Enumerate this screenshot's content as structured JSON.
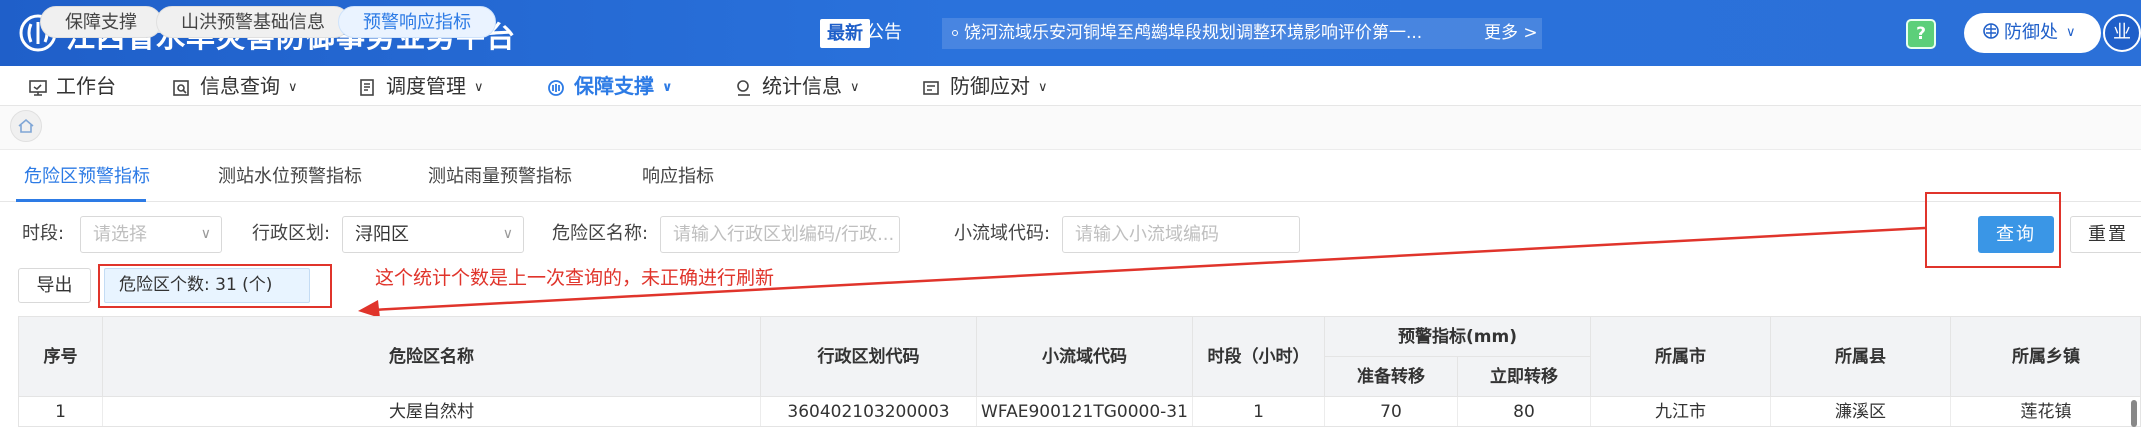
{
  "header": {
    "title": "江西省水旱灾害防御事务业务平台",
    "new_badge": "最新",
    "announcement_label": "公告",
    "announcement_text": "饶河流域乐安河铜埠至鸬鹚埠段规划调整环境影响评价第一...",
    "more": "更多 >",
    "help_icon": "?",
    "user": "防御处",
    "avatar": "业"
  },
  "nav": {
    "items": [
      {
        "label": "工作台"
      },
      {
        "label": "信息查询"
      },
      {
        "label": "调度管理"
      },
      {
        "label": "保障支撑"
      },
      {
        "label": "统计信息"
      },
      {
        "label": "防御应对"
      }
    ]
  },
  "breadcrumb": [
    "保障支撑",
    "山洪预警基础信息",
    "预警响应指标"
  ],
  "tabs": [
    "危险区预警指标",
    "测站水位预警指标",
    "测站雨量预警指标",
    "响应指标"
  ],
  "filters": {
    "period_label": "时段:",
    "period_placeholder": "请选择",
    "region_label": "行政区划:",
    "region_value": "浔阳区",
    "zone_label": "危险区名称:",
    "zone_placeholder": "请输入行政区划编码/行政...",
    "basin_label": "小流域代码:",
    "basin_placeholder": "请输入小流域编码"
  },
  "buttons": {
    "query": "查询",
    "reset": "重置",
    "export": "导出"
  },
  "count_text": "危险区个数: 31 (个)",
  "annotation": "这个统计个数是上一次查询的，未正确进行刷新",
  "table": {
    "headers": {
      "index": "序号",
      "name": "危险区名称",
      "region_code": "行政区划代码",
      "basin_code": "小流域代码",
      "period": "时段（小时）",
      "warning_group": "预警指标(mm)",
      "prepare": "准备转移",
      "immediate": "立即转移",
      "city": "所属市",
      "county": "所属县",
      "town": "所属乡镇"
    },
    "rows": [
      {
        "index": "1",
        "name": "大屋自然村",
        "region_code": "360402103200003",
        "basin_code": "WFAE900121TG0000-31",
        "period": "1",
        "prepare": "70",
        "immediate": "80",
        "city": "九江市",
        "county": "濂溪区",
        "town": "莲花镇"
      }
    ]
  },
  "colors": {
    "header_blue": "#2a72dc",
    "accent": "#2d7be5",
    "annotation_red": "#e0342b"
  }
}
